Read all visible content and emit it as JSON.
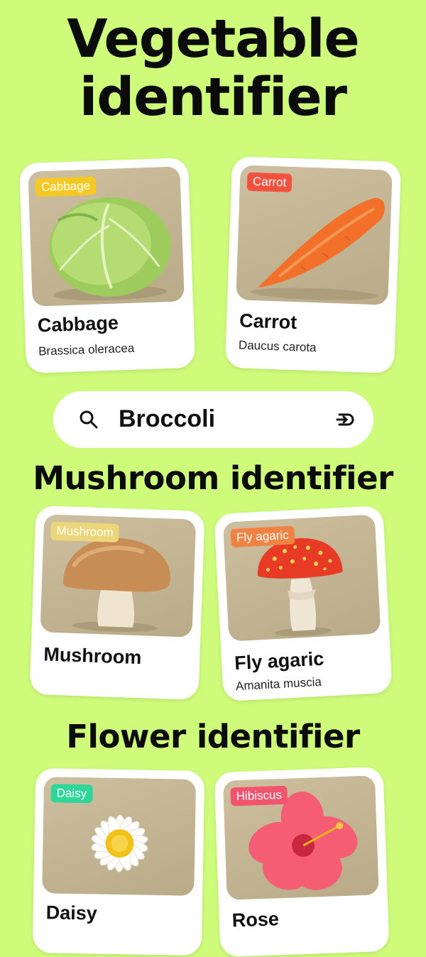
{
  "sections": {
    "vegetable_title": "Vegetable\nidentifier",
    "mushroom_title": "Mushroom identifier",
    "flower_title": "Flower identifier"
  },
  "search": {
    "value": "Broccoli",
    "icon": "search-icon",
    "submit_icon": "enter-arrow-icon"
  },
  "cards": {
    "cabbage": {
      "tag": "Cabbage",
      "name": "Cabbage",
      "scientific": "Brassica oleracea",
      "tag_color": "#f6c823"
    },
    "carrot": {
      "tag": "Carrot",
      "name": "Carrot",
      "scientific": "Daucus carota",
      "tag_color": "#f2513f"
    },
    "mushroom": {
      "tag": "Mushroom",
      "name": "Mushroom",
      "tag_color": "#ecd67a"
    },
    "fly_agaric": {
      "tag": "Fly agaric",
      "name": "Fly agaric",
      "scientific": "Amanita muscia",
      "tag_color": "#f08343"
    },
    "daisy": {
      "tag": "Daisy",
      "name": "Daisy",
      "tag_color": "#2fd69a"
    },
    "hibiscus": {
      "tag": "Hibiscus",
      "name": "Rose",
      "tag_color": "#f2536d"
    }
  },
  "colors": {
    "background": "#cefb7a",
    "card": "#ffffff"
  }
}
